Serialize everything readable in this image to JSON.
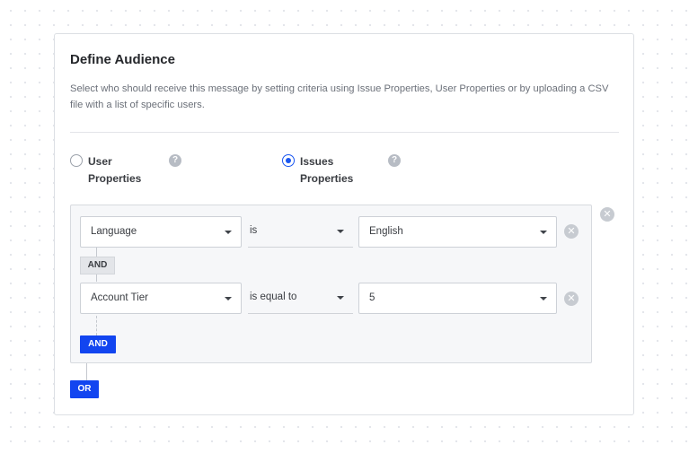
{
  "audience": {
    "title": "Define Audience",
    "description": "Select who should receive this message by setting criteria using Issue Properties, User Properties or by uploading a CSV file with a list of specific users.",
    "options": [
      {
        "label": "User Properties",
        "selected": false
      },
      {
        "label": "Issues Properties",
        "selected": true
      }
    ],
    "help_glyph": "?",
    "remove_glyph": "✕",
    "rules": [
      {
        "property": "Language",
        "operator": "is",
        "value": "English"
      },
      {
        "property": "Account Tier",
        "operator": "is equal to",
        "value": "5"
      }
    ],
    "and_badge": "AND",
    "and_button": "AND",
    "or_button": "OR"
  },
  "colors": {
    "accent": "#1245f0",
    "radio_selected": "#1a56f0",
    "remove_icon": "#c7cbd1",
    "help_icon": "#b7bcc4"
  },
  "icons": [
    "question-icon",
    "remove-icon",
    "chevron-down-icon"
  ]
}
